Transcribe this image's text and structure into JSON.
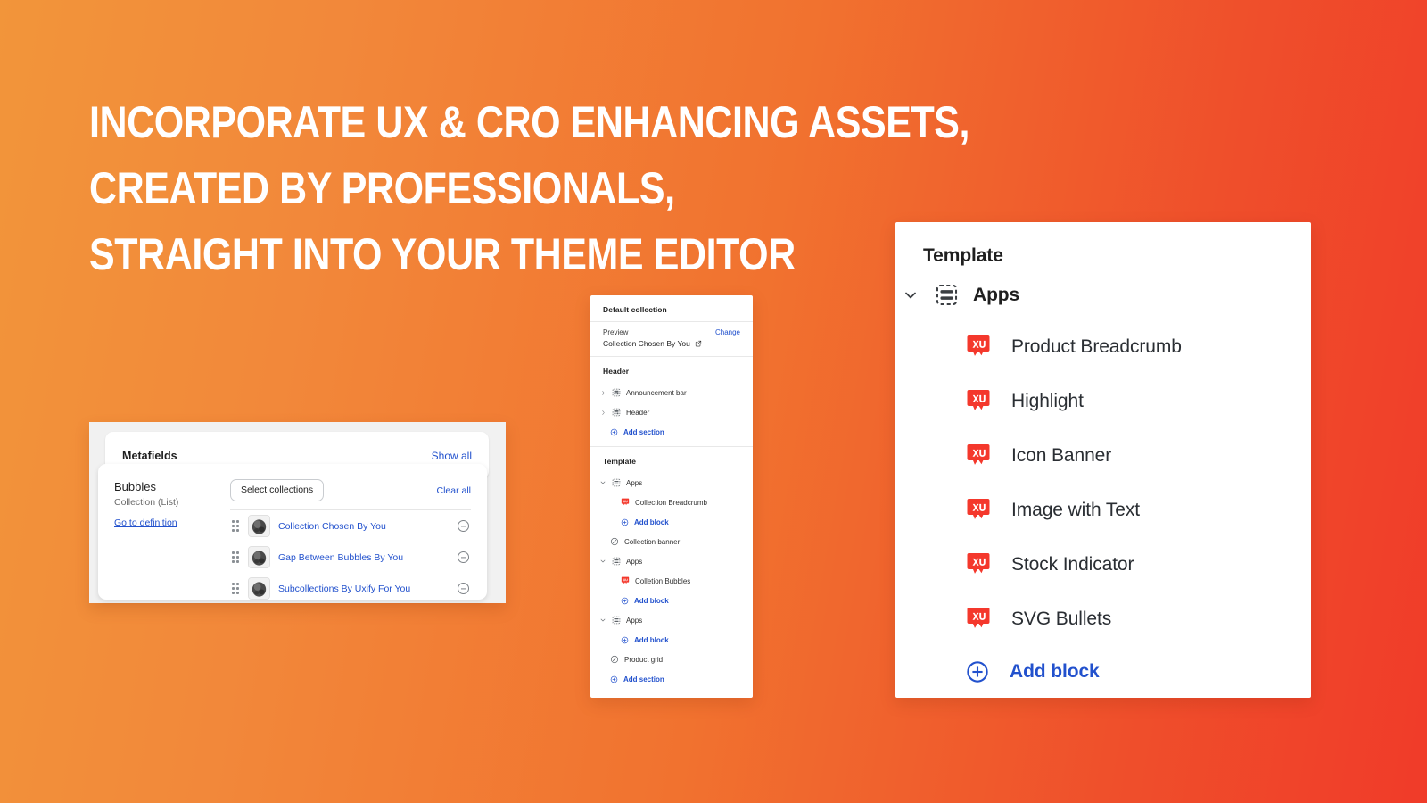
{
  "headline": {
    "lines": [
      "INCORPORATE UX & CRO ENHANCING ASSETS,",
      "CREATED BY PROFESSIONALS,",
      "STRAIGHT INTO YOUR THEME EDITOR"
    ],
    "color": "#ffffff"
  },
  "background": {
    "gradient_from": "#f2953a",
    "gradient_to": "#f03b29"
  },
  "metafields_card": {
    "title": "Metafields",
    "show_all_label": "Show all",
    "field_name": "Bubbles",
    "field_type": "Collection (List)",
    "go_to_definition_label": "Go to definition",
    "select_button_label": "Select collections",
    "clear_all_label": "Clear all",
    "link_color": "#2251cd",
    "rows": [
      {
        "label": "Collection Chosen By You",
        "thumb": "rock-thumbnail",
        "remove_label": "remove"
      },
      {
        "label": "Gap Between Bubbles By You",
        "thumb": "rock-thumbnail",
        "remove_label": "remove"
      },
      {
        "label": "Subcollections By Uxify For You",
        "thumb": "rock-thumbnail",
        "remove_label": "remove"
      }
    ]
  },
  "sections_panel": {
    "default_collection_label": "Default collection",
    "preview_label": "Preview",
    "change_label": "Change",
    "preview_value": "Collection Chosen By You",
    "header_group_label": "Header",
    "header_items": [
      {
        "label": "Announcement bar",
        "icon": "section-icon",
        "chevron": "right"
      },
      {
        "label": "Header",
        "icon": "section-icon",
        "chevron": "right"
      }
    ],
    "header_add_section_label": "Add section",
    "template_group_label": "Template",
    "template_items": [
      {
        "type": "section",
        "label": "Apps",
        "icon": "apps-icon",
        "chevron": "down"
      },
      {
        "type": "block",
        "label": "Collection Breadcrumb",
        "icon": "uxify-icon"
      },
      {
        "type": "add-block",
        "label": "Add block",
        "icon": "plus-circle-icon"
      },
      {
        "type": "section-plain",
        "label": "Collection banner",
        "icon": "slash-circle-icon"
      },
      {
        "type": "section",
        "label": "Apps",
        "icon": "apps-icon",
        "chevron": "down"
      },
      {
        "type": "block",
        "label": "Colletion Bubbles",
        "icon": "uxify-icon"
      },
      {
        "type": "add-block",
        "label": "Add block",
        "icon": "plus-circle-icon"
      },
      {
        "type": "section",
        "label": "Apps",
        "icon": "apps-icon",
        "chevron": "down"
      },
      {
        "type": "add-block",
        "label": "Add block",
        "icon": "plus-circle-icon"
      },
      {
        "type": "section-plain",
        "label": "Product grid",
        "icon": "slash-circle-icon"
      },
      {
        "type": "add-section",
        "label": "Add section",
        "icon": "plus-circle-icon"
      }
    ]
  },
  "template_panel": {
    "title": "Template",
    "apps_label": "Apps",
    "apps_icon": "apps-icon",
    "blocks": [
      {
        "label": "Product Breadcrumb",
        "icon": "uxify-icon"
      },
      {
        "label": "Highlight",
        "icon": "uxify-icon"
      },
      {
        "label": "Icon Banner",
        "icon": "uxify-icon"
      },
      {
        "label": "Image with Text",
        "icon": "uxify-icon"
      },
      {
        "label": "Stock Indicator",
        "icon": "uxify-icon"
      },
      {
        "label": "SVG Bullets",
        "icon": "uxify-icon"
      }
    ],
    "add_block_label": "Add block",
    "add_block_color": "#2251cd",
    "uxify_icon_color": "#f4382c"
  }
}
